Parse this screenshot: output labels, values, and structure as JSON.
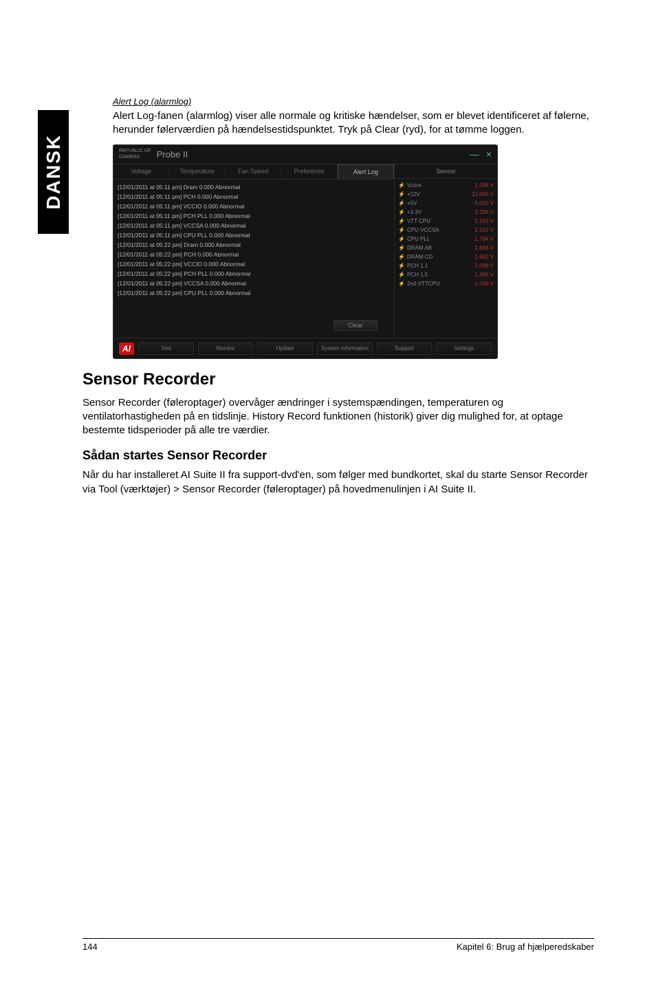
{
  "side_tab": "DANSK",
  "alert_log": {
    "heading": "Alert Log (alarmlog)",
    "text": "Alert Log-fanen (alarmlog) viser alle normale og kritiske hændelser, som er blevet identificeret af følerne, herunder følerværdien på hændelsestidspunktet. Tryk på Clear (ryd), for at tømme loggen."
  },
  "screenshot": {
    "logo_top": "REPUBLIC OF",
    "logo_bottom": "GAMERS",
    "title": "Probe II",
    "win_min": "—",
    "win_close": "×",
    "tabs": [
      "Voltage",
      "Temperature",
      "Fan Speed",
      "Preference",
      "Alert Log"
    ],
    "active_tab": 4,
    "lines": [
      "[12/01/2011 at 05:11 pm] Dram 0.000 Abnormal",
      "[12/01/2011 at 05:11 pm] PCH 0.000 Abnormal",
      "[12/01/2011 at 05:11 pm] VCCIO 0.000 Abnormal",
      "[12/01/2011 at 05:11 pm] PCH PLL 0.000 Abnormal",
      "[12/01/2011 at 05:11 pm] VCCSA 0.000 Abnormal",
      "[12/01/2011 at 05:11 pm] CPU PLL 0.000 Abnormal",
      "[12/01/2011 at 05:22 pm] Dram 0.000 Abnormal",
      "[12/01/2011 at 05:22 pm] PCH 0.000 Abnormal",
      "[12/01/2011 at 05:22 pm] VCCIO 0.000 Abnormal",
      "[12/01/2011 at 05:22 pm] PCH PLL 0.000 Abnormal",
      "[12/01/2011 at 05:22 pm] VCCSA 0.000 Abnormal",
      "[12/01/2011 at 05:22 pm] CPU PLL 0.000 Abnormal"
    ],
    "clear_btn": "Clear",
    "sensor_head": "Sensor",
    "sensors": [
      {
        "name": "Vcore",
        "val": "1.296 V"
      },
      {
        "name": "+12V",
        "val": "12.096 V"
      },
      {
        "name": "+5V",
        "val": "5.000 V"
      },
      {
        "name": "+3.3V",
        "val": "3.296 V"
      },
      {
        "name": "VTT CPU",
        "val": "1.155 V"
      },
      {
        "name": "CPU VCCSA",
        "val": "1.162 V"
      },
      {
        "name": "CPU PLL",
        "val": "1.794 V"
      },
      {
        "name": "DRAM AB",
        "val": "1.668 V"
      },
      {
        "name": "DRAM CD",
        "val": "1.662 V"
      },
      {
        "name": "PCH 1.1",
        "val": "1.098 V"
      },
      {
        "name": "PCH 1.5",
        "val": "1.495 V"
      },
      {
        "name": "2nd VTTCPU",
        "val": "1.048 V"
      }
    ],
    "bottom_logo": "AI",
    "bottom_buttons": [
      "Tool",
      "Monitor",
      "Update",
      "System\nInformation",
      "Support",
      "Settings"
    ]
  },
  "sensor_recorder": {
    "h2": "Sensor Recorder",
    "p1": "Sensor Recorder (føleroptager) overvåger ændringer i systemspændingen, temperaturen og ventilatorhastigheden på en tidslinje. History Record funktionen (historik) giver dig mulighed for, at optage bestemte tidsperioder på alle tre værdier.",
    "h3": "Sådan startes Sensor Recorder",
    "p2": "Når du har installeret AI Suite II fra support-dvd'en, som følger med bundkortet, skal du starte Sensor Recorder via Tool (værktøjer) > Sensor Recorder (føleroptager) på hovedmenulinjen i AI Suite II."
  },
  "footer": {
    "left": "144",
    "right": "Kapitel 6: Brug af hjælperedskaber"
  }
}
